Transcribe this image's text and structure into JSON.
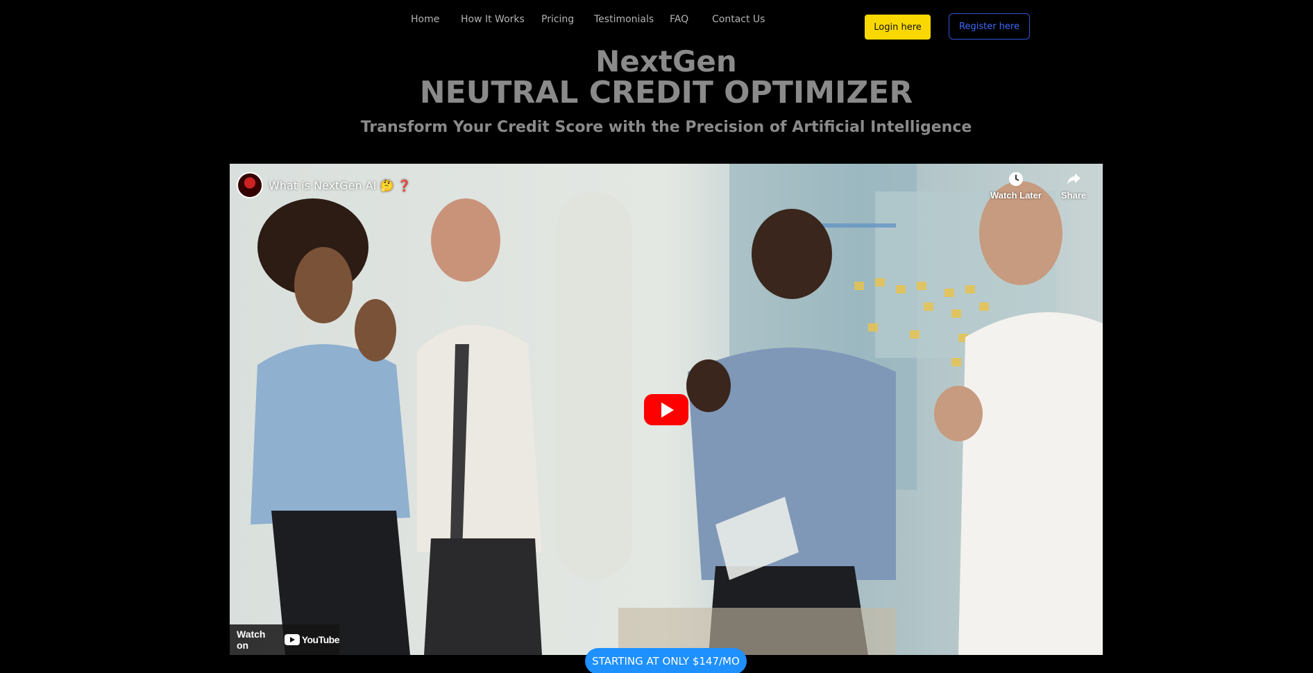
{
  "nav": {
    "items": [
      {
        "label": "Home"
      },
      {
        "label": "How It Works"
      },
      {
        "label": "Pricing"
      },
      {
        "label": "Testimonials"
      },
      {
        "label": "FAQ"
      },
      {
        "label": "Contact Us"
      }
    ],
    "login_label": "Login here",
    "register_label": "Register here"
  },
  "hero": {
    "title_line1": "NextGen",
    "title_line2": "NEUTRAL CREDIT OPTIMIZER",
    "subtitle": "Transform Your Credit Score with the Precision of Artificial Intelligence"
  },
  "video": {
    "title": "What is NextGen AI 🤔 ❓",
    "watch_later_label": "Watch Later",
    "share_label": "Share",
    "watch_on_label": "Watch on",
    "youtube_label": "YouTube"
  },
  "cta": {
    "label": "STARTING AT ONLY $147/MO"
  },
  "colors": {
    "background": "#000000",
    "login_bg": "#f8d800",
    "register_border": "#2f55d8",
    "cta_bg": "#1e90ff",
    "play_red": "#ff0000"
  }
}
